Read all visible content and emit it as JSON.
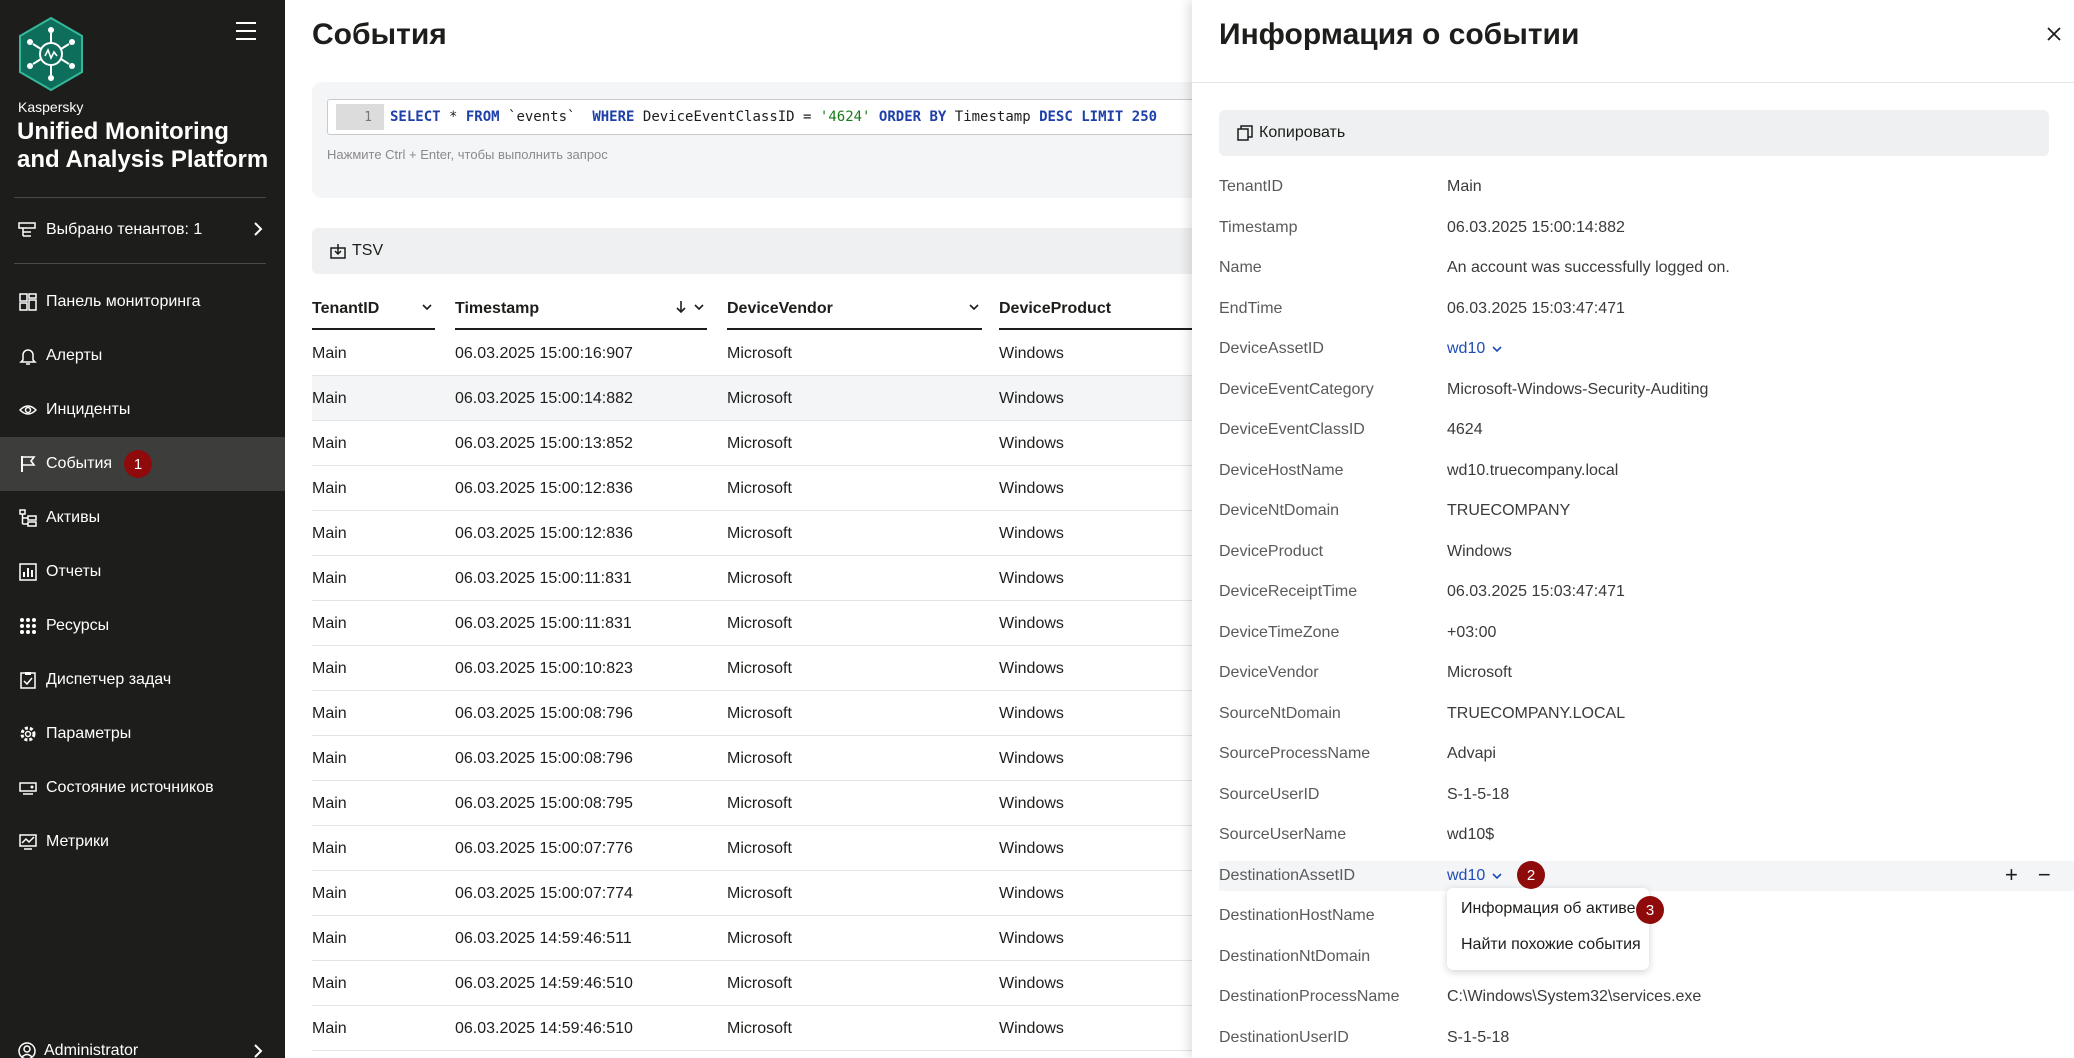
{
  "sidebar": {
    "brand_small": "Kaspersky",
    "brand_big": "Unified Monitoring and Analysis Platform",
    "tenant_label": "Выбрано тенантов: 1",
    "items": [
      {
        "label": "Панель мониторинга",
        "icon": "dashboard-icon"
      },
      {
        "label": "Алерты",
        "icon": "bell-icon"
      },
      {
        "label": "Инциденты",
        "icon": "eye-icon"
      },
      {
        "label": "События",
        "icon": "flag-icon",
        "badge": "1"
      },
      {
        "label": "Активы",
        "icon": "tree-icon"
      },
      {
        "label": "Отчеты",
        "icon": "report-icon"
      },
      {
        "label": "Ресурсы",
        "icon": "grid-icon"
      },
      {
        "label": "Диспетчер задач",
        "icon": "clipboard-icon"
      },
      {
        "label": "Параметры",
        "icon": "gear-icon"
      },
      {
        "label": "Состояние источников",
        "icon": "sources-icon"
      },
      {
        "label": "Метрики",
        "icon": "metrics-icon"
      }
    ],
    "user": "Administrator"
  },
  "main": {
    "title": "События",
    "query": {
      "line_number": "1",
      "tokens": {
        "select": "SELECT",
        "star": " * ",
        "from": "FROM",
        "table": " `events`  ",
        "where": "WHERE",
        "field": " DeviceEventClassID = ",
        "value": "'4624'",
        "order": " ORDER BY",
        "ts": " Timestamp ",
        "desc": "DESC",
        "limit": " LIMIT 250"
      },
      "hint": "Нажмите Ctrl + Enter, чтобы выполнить запрос"
    },
    "tsv_label": "TSV",
    "columns": [
      "TenantID",
      "Timestamp",
      "DeviceVendor",
      "DeviceProduct"
    ],
    "rows": [
      [
        "Main",
        "06.03.2025 15:00:16:907",
        "Microsoft",
        "Windows"
      ],
      [
        "Main",
        "06.03.2025 15:00:14:882",
        "Microsoft",
        "Windows"
      ],
      [
        "Main",
        "06.03.2025 15:00:13:852",
        "Microsoft",
        "Windows"
      ],
      [
        "Main",
        "06.03.2025 15:00:12:836",
        "Microsoft",
        "Windows"
      ],
      [
        "Main",
        "06.03.2025 15:00:12:836",
        "Microsoft",
        "Windows"
      ],
      [
        "Main",
        "06.03.2025 15:00:11:831",
        "Microsoft",
        "Windows"
      ],
      [
        "Main",
        "06.03.2025 15:00:11:831",
        "Microsoft",
        "Windows"
      ],
      [
        "Main",
        "06.03.2025 15:00:10:823",
        "Microsoft",
        "Windows"
      ],
      [
        "Main",
        "06.03.2025 15:00:08:796",
        "Microsoft",
        "Windows"
      ],
      [
        "Main",
        "06.03.2025 15:00:08:796",
        "Microsoft",
        "Windows"
      ],
      [
        "Main",
        "06.03.2025 15:00:08:795",
        "Microsoft",
        "Windows"
      ],
      [
        "Main",
        "06.03.2025 15:00:07:776",
        "Microsoft",
        "Windows"
      ],
      [
        "Main",
        "06.03.2025 15:00:07:774",
        "Microsoft",
        "Windows"
      ],
      [
        "Main",
        "06.03.2025 14:59:46:511",
        "Microsoft",
        "Windows"
      ],
      [
        "Main",
        "06.03.2025 14:59:46:510",
        "Microsoft",
        "Windows"
      ],
      [
        "Main",
        "06.03.2025 14:59:46:510",
        "Microsoft",
        "Windows"
      ]
    ]
  },
  "panel": {
    "title": "Информация о событии",
    "copy_label": "Копировать",
    "fields": [
      {
        "key": "TenantID",
        "value": "Main"
      },
      {
        "key": "Timestamp",
        "value": "06.03.2025 15:00:14:882"
      },
      {
        "key": "Name",
        "value": "An account was successfully logged on."
      },
      {
        "key": "EndTime",
        "value": "06.03.2025 15:03:47:471"
      },
      {
        "key": "DeviceAssetID",
        "value": "wd10",
        "link": true
      },
      {
        "key": "DeviceEventCategory",
        "value": "Microsoft-Windows-Security-Auditing"
      },
      {
        "key": "DeviceEventClassID",
        "value": "4624"
      },
      {
        "key": "DeviceHostName",
        "value": "wd10.truecompany.local"
      },
      {
        "key": "DeviceNtDomain",
        "value": "TRUECOMPANY"
      },
      {
        "key": "DeviceProduct",
        "value": "Windows"
      },
      {
        "key": "DeviceReceiptTime",
        "value": "06.03.2025 15:03:47:471"
      },
      {
        "key": "DeviceTimeZone",
        "value": "+03:00"
      },
      {
        "key": "DeviceVendor",
        "value": "Microsoft"
      },
      {
        "key": "SourceNtDomain",
        "value": "TRUECOMPANY.LOCAL"
      },
      {
        "key": "SourceProcessName",
        "value": "Advapi"
      },
      {
        "key": "SourceUserID",
        "value": "S-1-5-18"
      },
      {
        "key": "SourceUserName",
        "value": "wd10$"
      },
      {
        "key": "DestinationAssetID",
        "value": "wd10",
        "link": true
      },
      {
        "key": "DestinationHostName",
        "value": ""
      },
      {
        "key": "DestinationNtDomain",
        "value": ""
      },
      {
        "key": "DestinationProcessName",
        "value": "C:\\Windows\\System32\\services.exe"
      },
      {
        "key": "DestinationUserID",
        "value": "S-1-5-18"
      }
    ],
    "row_actions": {
      "add": "+",
      "remove": "−"
    },
    "dropdown": {
      "items": [
        "Информация об активе",
        "Найти похожие события"
      ]
    },
    "badges": {
      "b2": "2",
      "b3": "3"
    }
  },
  "colors": {
    "sidebar_bg": "#1d1d1b",
    "active_nav": "#3d3d3b",
    "badge": "#8f0a0a",
    "link": "#1e4bb8"
  }
}
